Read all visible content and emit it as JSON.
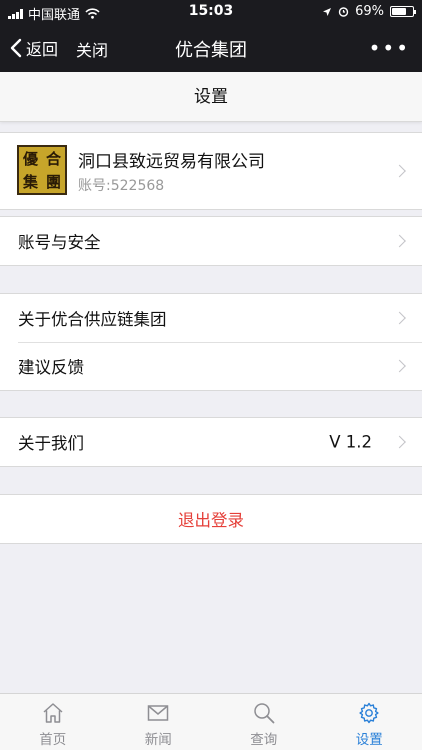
{
  "status_bar": {
    "carrier": "中国联通",
    "time": "15:03",
    "battery": "69%",
    "battery_level": 0.69
  },
  "nav": {
    "back_label": "返回",
    "close_label": "关闭",
    "title": "优合集团",
    "more_label": "•••"
  },
  "page": {
    "title": "设置"
  },
  "profile": {
    "logo_chars": [
      "優",
      "合",
      "集",
      "團"
    ],
    "name": "洞口县致远贸易有限公司",
    "account": "账号:522568"
  },
  "menu": {
    "account_security": "账号与安全",
    "about_supply_chain": "关于优合供应链集团",
    "feedback": "建议反馈",
    "about_us": "关于我们",
    "version": "V 1.2",
    "logout": "退出登录"
  },
  "tabs": [
    {
      "label": "首页",
      "icon": "home-icon"
    },
    {
      "label": "新闻",
      "icon": "mail-icon"
    },
    {
      "label": "查询",
      "icon": "search-icon"
    },
    {
      "label": "设置",
      "icon": "gear-icon",
      "active": true
    }
  ],
  "colors": {
    "accent": "#2a80d8",
    "logout": "#e5403a",
    "navbar": "#1b1b1f",
    "logo_bg": "#c7a52a"
  }
}
